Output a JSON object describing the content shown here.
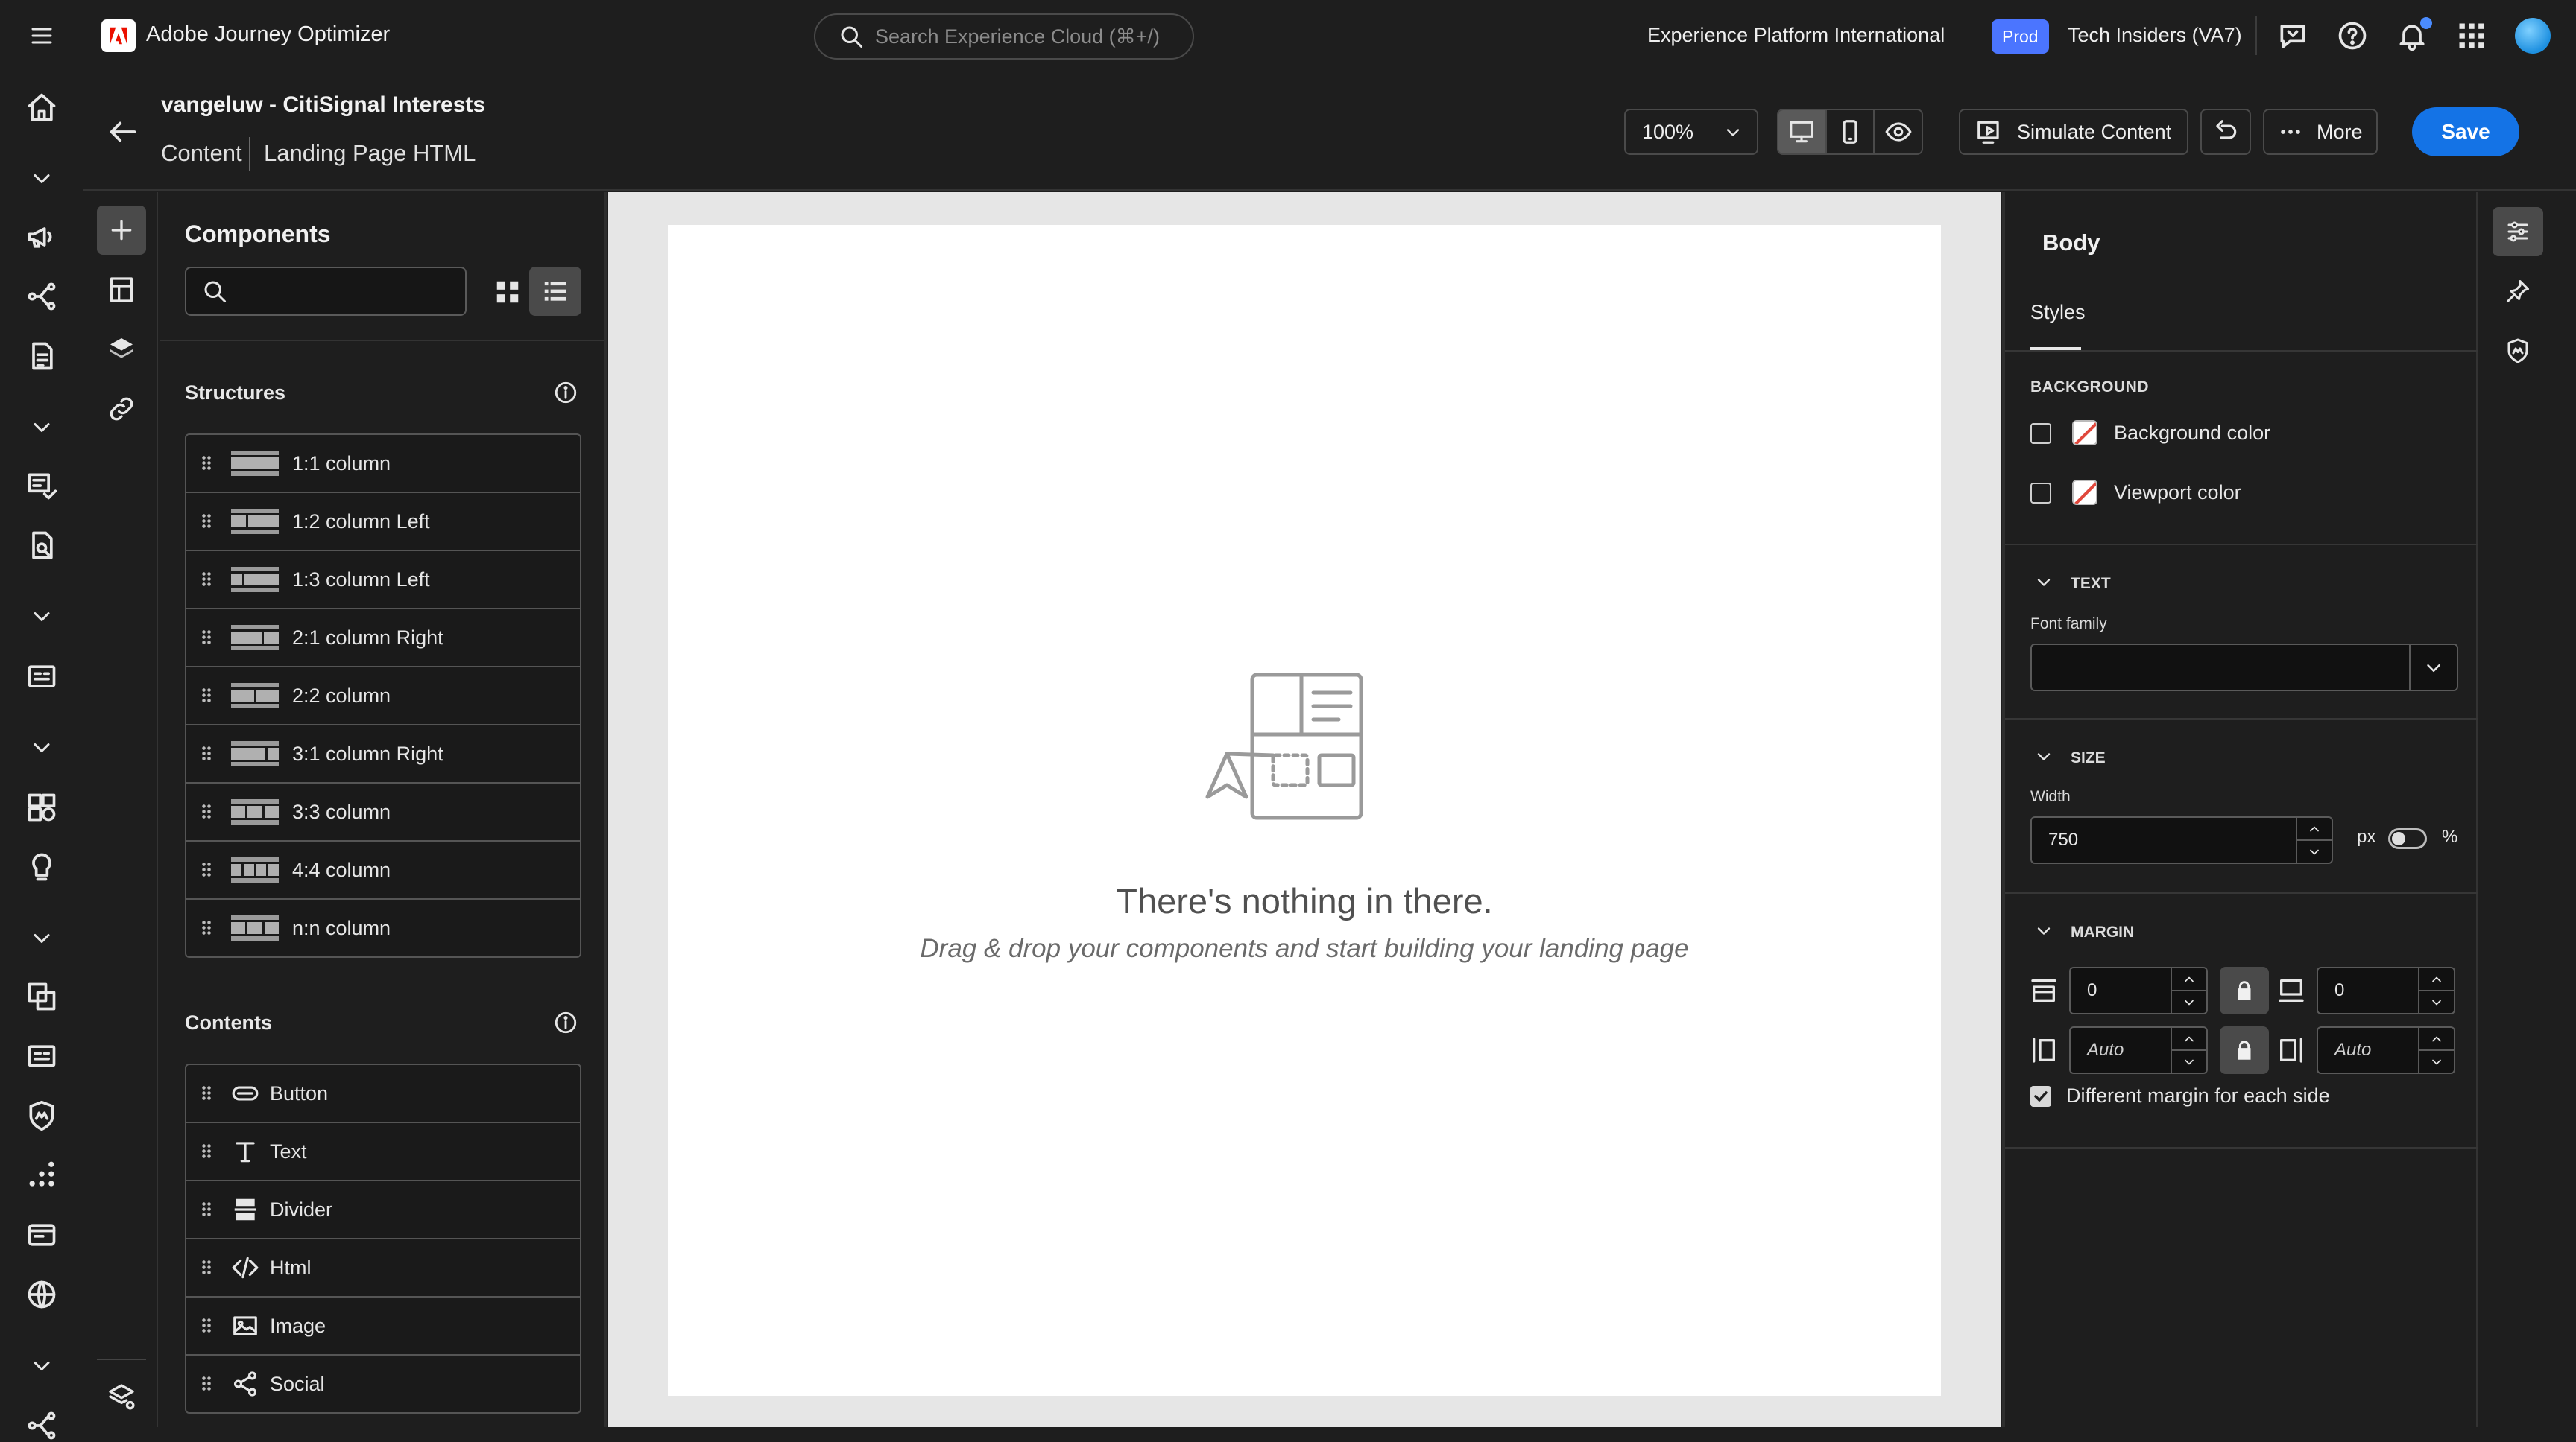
{
  "app": {
    "name": "Adobe Journey Optimizer",
    "search_placeholder": "Search Experience Cloud (⌘+/)",
    "org": "Experience Platform International",
    "env_badge": "Prod",
    "sandbox": "Tech Insiders (VA7)",
    "accent_color": "#1473e6",
    "badge_color": "#4b75ff"
  },
  "editor": {
    "title": "vangeluw - CitiSignal Interests",
    "breadcrumb": [
      "Content",
      "Landing Page HTML"
    ],
    "zoom": "100%",
    "device_modes": [
      "desktop-icon",
      "mobile-icon",
      "preview-eye-icon"
    ],
    "active_device": "desktop",
    "simulate_label": "Simulate Content",
    "more_label": "More",
    "save_label": "Save"
  },
  "components": {
    "title": "Components",
    "search_value": "",
    "view_mode": "list",
    "structures_title": "Structures",
    "structures": [
      {
        "label": "1:1 column",
        "cols": [
          1
        ]
      },
      {
        "label": "1:2 column Left",
        "cols": [
          1,
          2
        ]
      },
      {
        "label": "1:3 column Left",
        "cols": [
          1,
          3
        ]
      },
      {
        "label": "2:1 column Right",
        "cols": [
          2,
          1
        ]
      },
      {
        "label": "2:2 column",
        "cols": [
          1,
          1
        ]
      },
      {
        "label": "3:1 column Right",
        "cols": [
          3,
          1
        ]
      },
      {
        "label": "3:3 column",
        "cols": [
          1,
          1,
          1
        ]
      },
      {
        "label": "4:4 column",
        "cols": [
          1,
          1,
          1,
          1
        ]
      },
      {
        "label": "n:n column",
        "cols": [
          1,
          1,
          1
        ]
      }
    ],
    "contents_title": "Contents",
    "contents": [
      {
        "label": "Button",
        "icon": "button-icon"
      },
      {
        "label": "Text",
        "icon": "text-icon"
      },
      {
        "label": "Divider",
        "icon": "divider-icon"
      },
      {
        "label": "Html",
        "icon": "code-icon"
      },
      {
        "label": "Image",
        "icon": "image-icon"
      },
      {
        "label": "Social",
        "icon": "share-icon"
      }
    ]
  },
  "canvas": {
    "empty_title": "There's nothing in there.",
    "empty_hint": "Drag & drop your components and start building your landing page"
  },
  "properties": {
    "title": "Body",
    "tab": "Styles",
    "background": {
      "section": "BACKGROUND",
      "bg_color_label": "Background color",
      "bg_color_checked": false,
      "viewport_color_label": "Viewport color",
      "viewport_color_checked": false
    },
    "text": {
      "section": "TEXT",
      "font_family_label": "Font family",
      "font_family_value": ""
    },
    "size": {
      "section": "SIZE",
      "width_label": "Width",
      "width_value": "750",
      "unit_px": "px",
      "unit_pct": "%",
      "unit_is_percent": false
    },
    "margin": {
      "section": "MARGIN",
      "top": "0",
      "bottom": "0",
      "left": "Auto",
      "right": "Auto",
      "different_each_side_label": "Different margin for each side",
      "different_each_side_checked": true
    }
  }
}
